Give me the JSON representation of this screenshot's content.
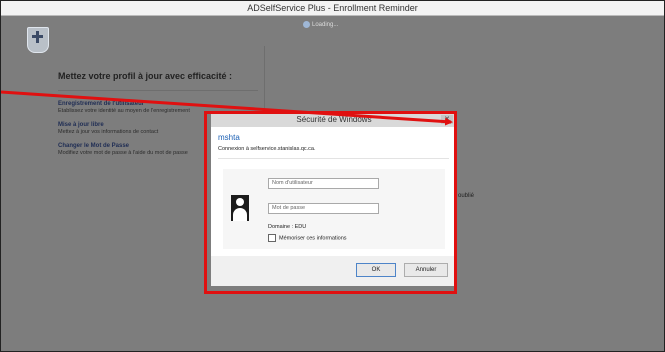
{
  "window": {
    "title": "ADSelfService Plus - Enrollment Reminder",
    "loading": "Loading..."
  },
  "page": {
    "heading": "Mettez votre profil à jour avec efficacité :",
    "links": [
      {
        "title": "Enregistrement de l'utilisateur",
        "desc": "Établissez votre identité au moyen de l'enregistrement"
      },
      {
        "title": "Mise à jour libre",
        "desc": "Mettez à jour vos informations de contact"
      },
      {
        "title": "Changer le Mot de Passe",
        "desc": "Modifiez votre mot de passe à l'aide du mot de passe"
      }
    ],
    "side_text": "oublié"
  },
  "dialog": {
    "title": "Sécurité de Windows",
    "close": "✕",
    "app": "mshta",
    "connection": "Connexion à selfservice.stanislas.qc.ca.",
    "username_placeholder": "Nom d'utilisateur",
    "password_placeholder": "Mot de passe",
    "domain": "Domaine : EDU",
    "remember": "Mémoriser ces informations",
    "ok": "OK",
    "cancel": "Annuler"
  },
  "annotation": {
    "color": "#e01010"
  }
}
